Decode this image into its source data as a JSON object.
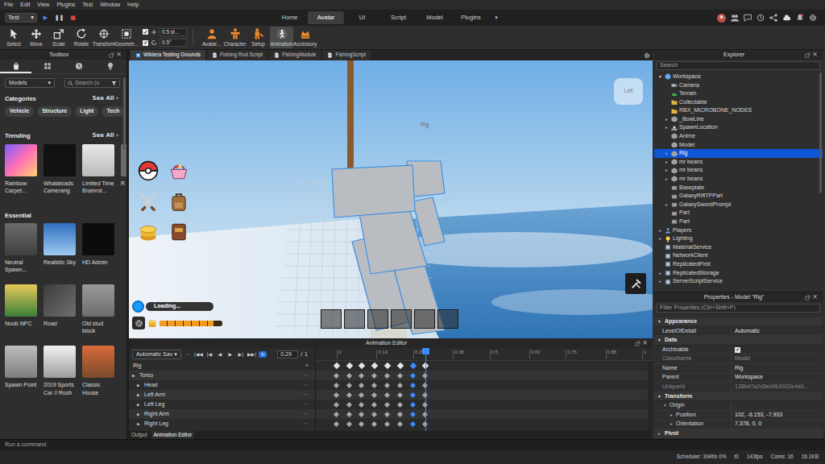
{
  "menu": [
    "File",
    "Edit",
    "View",
    "Plugins",
    "Test",
    "Window",
    "Help"
  ],
  "mode_select": {
    "value": "Test",
    "arrow": "▾"
  },
  "run_controls": [
    {
      "glyph": "▶",
      "kind": "play"
    },
    {
      "glyph": "❚❚",
      "kind": "pause"
    },
    {
      "glyph": "■",
      "kind": "stop"
    }
  ],
  "ribbon_tabs": [
    {
      "label": "Home",
      "selected": false
    },
    {
      "label": "Avatar",
      "selected": true
    },
    {
      "label": "UI",
      "selected": false
    },
    {
      "label": "Script",
      "selected": false
    },
    {
      "label": "Model",
      "selected": false
    },
    {
      "label": "Plugins",
      "selected": false
    }
  ],
  "ribbon_more": "▾",
  "tools": [
    {
      "label": "Select",
      "kind": "select"
    },
    {
      "label": "Move",
      "kind": "move"
    },
    {
      "label": "Scale",
      "kind": "scale"
    },
    {
      "label": "Rotate",
      "kind": "rotate"
    },
    {
      "label": "Transform",
      "kind": "transform"
    },
    {
      "label": "Geometr...",
      "kind": "geometry"
    }
  ],
  "snaps": [
    {
      "checked": true,
      "value": "0.5 st...",
      "kind": "move"
    },
    {
      "checked": true,
      "value": "0.5°",
      "kind": "rotate"
    }
  ],
  "avatar_tools": [
    {
      "label": "Avatar...",
      "kind": "avatar",
      "selected": false
    },
    {
      "label": "Character",
      "kind": "character",
      "selected": false
    },
    {
      "label": "Setup",
      "kind": "setup",
      "selected": false
    },
    {
      "label": "Animation",
      "kind": "animation",
      "selected": true
    },
    {
      "label": "Accessory",
      "kind": "accessory",
      "selected": false
    }
  ],
  "toolbox": {
    "title": "Toolbox",
    "close": "×",
    "tabs": [
      {
        "kind": "marketplace",
        "selected": true
      },
      {
        "kind": "inventory",
        "selected": false
      },
      {
        "kind": "recent",
        "selected": false
      },
      {
        "kind": "creations",
        "selected": false
      }
    ],
    "category": "Models",
    "category_arrow": "▾",
    "search_placeholder": "Search (u",
    "categories": {
      "title": "Categories",
      "see_all": "See All ›",
      "chips": [
        "Vehicle",
        "Structure",
        "Light",
        "Tech"
      ]
    },
    "trending": {
      "title": "Trending",
      "see_all": "See All ›",
      "items": [
        "Rainbow Carpet...",
        "Whataloads Camerarig",
        "Limited Time Brainrot...",
        "R"
      ]
    },
    "essential": {
      "title": "Essential",
      "items": [
        "Neutral Spawn...",
        "Realistic Sky",
        "HD Admin",
        "Noob NPC",
        "Road",
        "Old stud block",
        "Spawn Point",
        "2019 Sports Car // Rosh",
        "Classic House"
      ]
    }
  },
  "doc_tabs": [
    {
      "label": "Wildera Testing Grounds",
      "kind": "place",
      "selected": true
    },
    {
      "label": "Fishing Rod Script",
      "kind": "script",
      "selected": false
    },
    {
      "label": "FishingModule",
      "kind": "module",
      "selected": false
    },
    {
      "label": "FishingScript",
      "kind": "script",
      "selected": false
    }
  ],
  "viewport": {
    "label": "Rig",
    "view_cube": "Left",
    "hud": {
      "loading": "Loading...",
      "energy": {
        "level": 0.86
      },
      "slots": [
        {
          "filled": false
        },
        {
          "filled": false
        },
        {
          "filled": false
        },
        {
          "filled": false
        },
        {
          "filled": false
        },
        {
          "filled": false
        }
      ]
    }
  },
  "animation_editor": {
    "title": "Animation Editor",
    "close": "×",
    "save_mode": "Automatic Sav",
    "save_arrow": "▾",
    "menu": "⋯",
    "transport": [
      {
        "glyph": "|◀◀",
        "selected": false
      },
      {
        "glyph": "|◀",
        "selected": false
      },
      {
        "glyph": "◀",
        "selected": false
      },
      {
        "glyph": "▶",
        "selected": false
      },
      {
        "glyph": "▶|",
        "selected": false
      },
      {
        "glyph": "▶▶|",
        "selected": false
      },
      {
        "glyph": "↻",
        "selected": true
      }
    ],
    "time": "0.29",
    "separator": "/",
    "length": "1",
    "ticks": [
      "0",
      "0.13",
      "0.25",
      "0.38",
      "0.5",
      "0.63",
      "0.75",
      "0.88",
      "1"
    ],
    "root_track": {
      "label": "Rig",
      "add": "+"
    },
    "tracks": [
      {
        "label": "Torso",
        "toggle": "▶",
        "menu": "⋯",
        "depth": 0
      },
      {
        "label": "Head",
        "toggle": "▶",
        "menu": "⋯",
        "depth": 1
      },
      {
        "label": "Left Arm",
        "toggle": "▶",
        "menu": "⋯",
        "depth": 1
      },
      {
        "label": "Left Leg",
        "toggle": "▶",
        "menu": "⋯",
        "depth": 1
      },
      {
        "label": "Right Arm",
        "toggle": "▶",
        "menu": "⋯",
        "depth": 1
      },
      {
        "label": "Right Leg",
        "toggle": "▶",
        "menu": "⋯",
        "depth": 1
      }
    ],
    "keyframes": [
      {
        "time": 0,
        "selected": false
      },
      {
        "time": 0.042,
        "selected": false
      },
      {
        "time": 0.083,
        "selected": false
      },
      {
        "time": 0.125,
        "selected": false
      },
      {
        "time": 0.167,
        "selected": false
      },
      {
        "time": 0.208,
        "selected": false
      },
      {
        "time": 0.25,
        "selected": true
      },
      {
        "time": 0.29,
        "selected": false
      }
    ],
    "tabs": [
      {
        "label": "Output",
        "selected": false
      },
      {
        "label": "Animation Editor",
        "selected": true
      }
    ]
  },
  "explorer": {
    "title": "Explorer",
    "close": "×",
    "search_placeholder": "Search",
    "items": [
      {
        "label": "Workspace",
        "depth": 0,
        "toggle": "▾",
        "expanded": true,
        "selected": false,
        "kind": "workspace"
      },
      {
        "label": "Camera",
        "depth": 1,
        "selected": false,
        "kind": "camera"
      },
      {
        "label": "Terrain",
        "depth": 1,
        "selected": false,
        "kind": "terrain"
      },
      {
        "label": "Collectable",
        "depth": 1,
        "selected": false,
        "kind": "folder"
      },
      {
        "label": "RBX_MICROBONE_NODES",
        "depth": 1,
        "selected": false,
        "kind": "folder"
      },
      {
        "label": "_BowLine",
        "depth": 1,
        "toggle": "▸",
        "expanded": false,
        "selected": false,
        "kind": "model"
      },
      {
        "label": "SpawnLocation",
        "depth": 1,
        "toggle": "▸",
        "expanded": false,
        "selected": false,
        "kind": "spawn"
      },
      {
        "label": "Anime",
        "depth": 1,
        "selected": false,
        "kind": "model"
      },
      {
        "label": "Model",
        "depth": 1,
        "selected": false,
        "kind": "model"
      },
      {
        "label": "Rig",
        "depth": 1,
        "toggle": "▸",
        "expanded": false,
        "selected": true,
        "kind": "model"
      },
      {
        "label": "mr beans",
        "depth": 1,
        "toggle": "▸",
        "expanded": false,
        "selected": false,
        "kind": "model"
      },
      {
        "label": "mr beans",
        "depth": 1,
        "toggle": "▸",
        "expanded": false,
        "selected": false,
        "kind": "model"
      },
      {
        "label": "mr beans",
        "depth": 1,
        "toggle": "▸",
        "expanded": false,
        "selected": false,
        "kind": "model"
      },
      {
        "label": "Baseplate",
        "depth": 1,
        "selected": false,
        "kind": "part"
      },
      {
        "label": "GalaxyRiftTPPart",
        "depth": 1,
        "selected": false,
        "kind": "part"
      },
      {
        "label": "GalaxySwordPrompt",
        "depth": 1,
        "toggle": "▸",
        "expanded": false,
        "selected": false,
        "kind": "part"
      },
      {
        "label": "Part",
        "depth": 1,
        "selected": false,
        "kind": "part"
      },
      {
        "label": "Part",
        "depth": 1,
        "selected": false,
        "kind": "part"
      },
      {
        "label": "Players",
        "depth": 0,
        "toggle": "▸",
        "expanded": false,
        "selected": false,
        "kind": "players"
      },
      {
        "label": "Lighting",
        "depth": 0,
        "toggle": "▸",
        "expanded": false,
        "selected": false,
        "kind": "lighting"
      },
      {
        "label": "MaterialService",
        "depth": 0,
        "selected": false,
        "kind": "service"
      },
      {
        "label": "NetworkClient",
        "depth": 0,
        "selected": false,
        "kind": "service"
      },
      {
        "label": "ReplicatedFirst",
        "depth": 0,
        "selected": false,
        "kind": "service"
      },
      {
        "label": "ReplicatedStorage",
        "depth": 0,
        "toggle": "▸",
        "expanded": false,
        "selected": false,
        "kind": "service"
      },
      {
        "label": "ServerScriptService",
        "depth": 0,
        "toggle": "▸",
        "expanded": false,
        "selected": false,
        "kind": "service"
      }
    ]
  },
  "properties": {
    "title": "Properties - Model \"Rig\"",
    "close": "×",
    "filter_placeholder": "Filter Properties (Ctrl+Shift+P)",
    "sections": [
      {
        "title": "Appearance",
        "toggle": "▾",
        "expanded": true,
        "rows": [
          {
            "name": "LevelOfDetail",
            "value": "Automatic",
            "kind": "text",
            "disabled": false,
            "depth": 0
          }
        ]
      },
      {
        "title": "Data",
        "toggle": "▾",
        "expanded": true,
        "rows": [
          {
            "name": "Archivable",
            "kind": "check",
            "checked": true,
            "disabled": false,
            "depth": 0
          },
          {
            "name": "ClassName",
            "value": "Model",
            "kind": "text",
            "disabled": true,
            "depth": 0
          },
          {
            "name": "Name",
            "value": "Rig",
            "kind": "text",
            "disabled": false,
            "depth": 0
          },
          {
            "name": "Parent",
            "value": "Workspace",
            "kind": "text",
            "disabled": false,
            "depth": 0
          },
          {
            "name": "UniqueId",
            "value": "128b47a2d3ed9b3932e4a0...",
            "kind": "text",
            "disabled": true,
            "depth": 0
          }
        ]
      },
      {
        "title": "Transform",
        "toggle": "▾",
        "expanded": true,
        "rows": [
          {
            "name": "Origin",
            "toggle": "▾",
            "kind": "group",
            "disabled": false,
            "depth": 0
          },
          {
            "name": "Position",
            "toggle": "▸",
            "value": "102, -6.153, -7.933",
            "kind": "text",
            "disabled": false,
            "depth": 1
          },
          {
            "name": "Orientation",
            "toggle": "▸",
            "value": "7.378, 0, 0",
            "kind": "text",
            "disabled": false,
            "depth": 1
          }
        ]
      },
      {
        "title": "Pivot",
        "toggle": "▸",
        "expanded": false,
        "rows": []
      }
    ]
  },
  "command_placeholder": "Run a command",
  "status": [
    "Scheduler: 394f/s 0%",
    "t0",
    "143fps",
    "Cores: 16",
    "16.1KB"
  ]
}
